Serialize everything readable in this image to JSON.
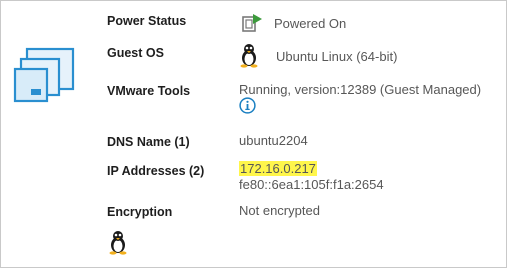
{
  "power_status": {
    "label": "Power Status",
    "value": "Powered On",
    "icon": "power-on-icon"
  },
  "guest_os": {
    "label": "Guest OS",
    "value": "Ubuntu Linux (64-bit)",
    "icon": "linux-tux-icon"
  },
  "vmware_tools": {
    "label": "VMware Tools",
    "value": "Running, version:12389 (Guest Managed)",
    "info_icon": "info-icon"
  },
  "dns_name": {
    "label": "DNS Name (1)",
    "value": "ubuntu2204"
  },
  "ip_addresses": {
    "label": "IP Addresses (2)",
    "values": [
      "172.16.0.217",
      "fe80::6ea1:105f:f1a:2654"
    ]
  },
  "encryption": {
    "label": "Encryption",
    "value": "Not encrypted"
  },
  "colors": {
    "highlight": "#fff64b",
    "accent_blue": "#1a7fc1",
    "power_green": "#3c9a3c"
  }
}
